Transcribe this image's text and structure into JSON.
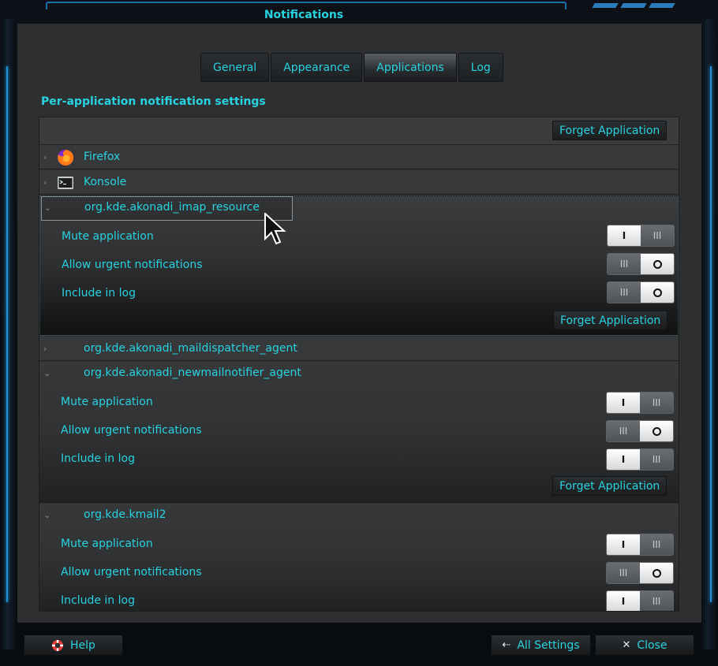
{
  "window": {
    "title": "Notifications"
  },
  "tabs": [
    {
      "label": "General",
      "active": false
    },
    {
      "label": "Appearance",
      "active": false
    },
    {
      "label": "Applications",
      "active": true
    },
    {
      "label": "Log",
      "active": false
    }
  ],
  "section_title": "Per-application notification settings",
  "forget_label": "Forget Application",
  "options": {
    "mute": "Mute application",
    "urgent": "Allow urgent notifications",
    "log": "Include in log"
  },
  "apps": [
    {
      "name": "Firefox",
      "icon": "firefox-icon",
      "expanded": false
    },
    {
      "name": "Konsole",
      "icon": "konsole-icon",
      "expanded": false
    },
    {
      "name": "org.kde.akonadi_imap_resource",
      "expanded": true,
      "mute": false,
      "urgent": true,
      "log": true
    },
    {
      "name": "org.kde.akonadi_maildispatcher_agent",
      "expanded": false
    },
    {
      "name": "org.kde.akonadi_newmailnotifier_agent",
      "expanded": true,
      "mute": false,
      "urgent": true,
      "log": false
    },
    {
      "name": "org.kde.kmail2",
      "expanded": true,
      "mute": false,
      "urgent": true,
      "log": false
    }
  ],
  "bottom": {
    "help": "Help",
    "all_settings": "All Settings",
    "close": "Close"
  },
  "colors": {
    "accent": "#27d3e0",
    "frame": "#1f8fd6",
    "background": "#2d2f31"
  }
}
